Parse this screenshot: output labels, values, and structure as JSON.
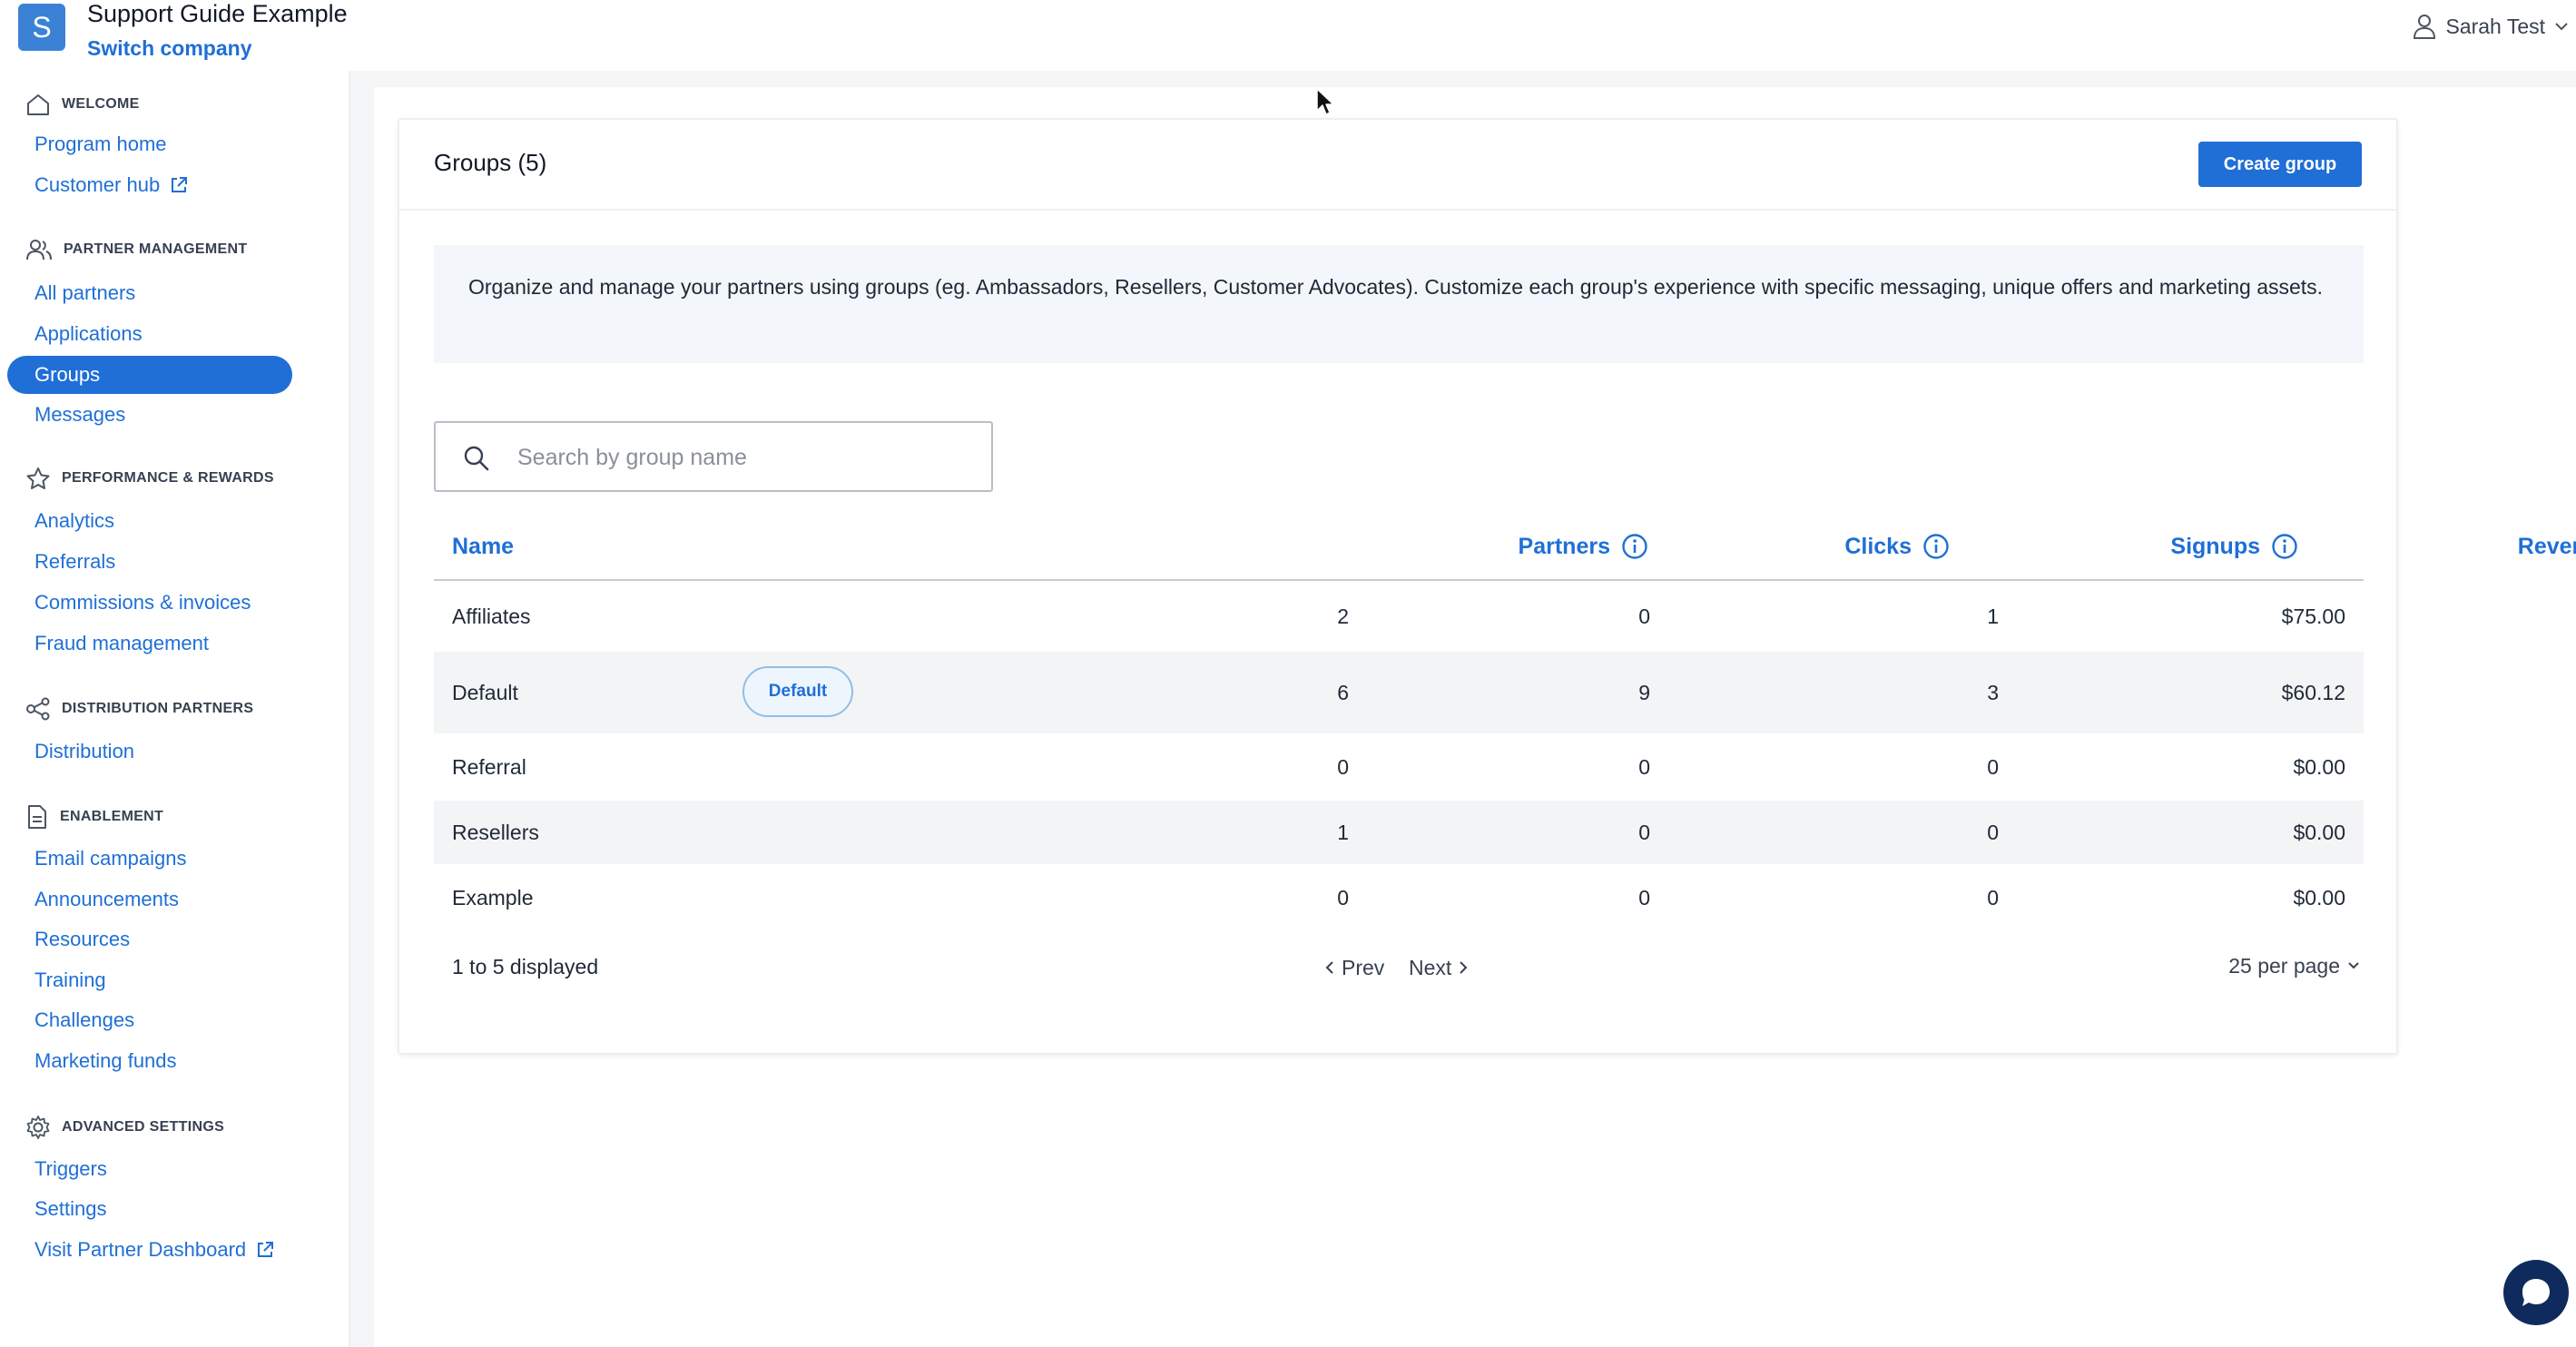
{
  "header": {
    "logo_letter": "S",
    "app_title": "Support Guide Example",
    "switch_company": "Switch company",
    "user_name": "Sarah Test"
  },
  "sidebar": {
    "sections": [
      {
        "title": "WELCOME",
        "icon": "home-icon"
      },
      {
        "title": "PARTNER MANAGEMENT",
        "icon": "users-icon"
      },
      {
        "title": "PERFORMANCE & REWARDS",
        "icon": "star-icon"
      },
      {
        "title": "DISTRIBUTION PARTNERS",
        "icon": "share-icon"
      },
      {
        "title": "ENABLEMENT",
        "icon": "document-icon"
      },
      {
        "title": "ADVANCED SETTINGS",
        "icon": "gear-icon"
      }
    ],
    "items": [
      {
        "label": "Program home"
      },
      {
        "label": "Customer hub"
      },
      {
        "label": "All partners"
      },
      {
        "label": "Applications"
      },
      {
        "label": "Groups",
        "active": true
      },
      {
        "label": "Messages"
      },
      {
        "label": "Analytics"
      },
      {
        "label": "Referrals"
      },
      {
        "label": "Commissions & invoices"
      },
      {
        "label": "Fraud management"
      },
      {
        "label": "Distribution"
      },
      {
        "label": "Email campaigns"
      },
      {
        "label": "Announcements"
      },
      {
        "label": "Resources"
      },
      {
        "label": "Training"
      },
      {
        "label": "Challenges"
      },
      {
        "label": "Marketing funds"
      },
      {
        "label": "Triggers"
      },
      {
        "label": "Settings"
      },
      {
        "label": "Visit Partner Dashboard"
      }
    ]
  },
  "main": {
    "title": "Groups (5)",
    "create_button": "Create group",
    "info_text": "Organize and manage your partners using groups (eg. Ambassadors, Resellers, Customer Advocates). Customize each group's experience with specific messaging, unique offers and marketing assets.",
    "search_placeholder": "Search by group name",
    "columns": [
      "Name",
      "Partners",
      "Clicks",
      "Signups",
      "Revenue"
    ],
    "rows": [
      {
        "name": "Affiliates",
        "badge": "",
        "partners": "2",
        "clicks": "0",
        "signups": "1",
        "revenue": "$75.00"
      },
      {
        "name": "Default",
        "badge": "Default",
        "partners": "6",
        "clicks": "9",
        "signups": "3",
        "revenue": "$60.12"
      },
      {
        "name": "Referral",
        "badge": "",
        "partners": "0",
        "clicks": "0",
        "signups": "0",
        "revenue": "$0.00"
      },
      {
        "name": "Resellers",
        "badge": "",
        "partners": "1",
        "clicks": "0",
        "signups": "0",
        "revenue": "$0.00"
      },
      {
        "name": "Example",
        "badge": "",
        "partners": "0",
        "clicks": "0",
        "signups": "0",
        "revenue": "$0.00"
      }
    ],
    "footer": {
      "count_text": "1 to 5 displayed",
      "prev": "Prev",
      "next": "Next",
      "per_page": "25 per page"
    }
  },
  "colors": {
    "accent": "#1f6fd6",
    "logo": "#3b82d6",
    "chat": "#0f2a5c"
  }
}
